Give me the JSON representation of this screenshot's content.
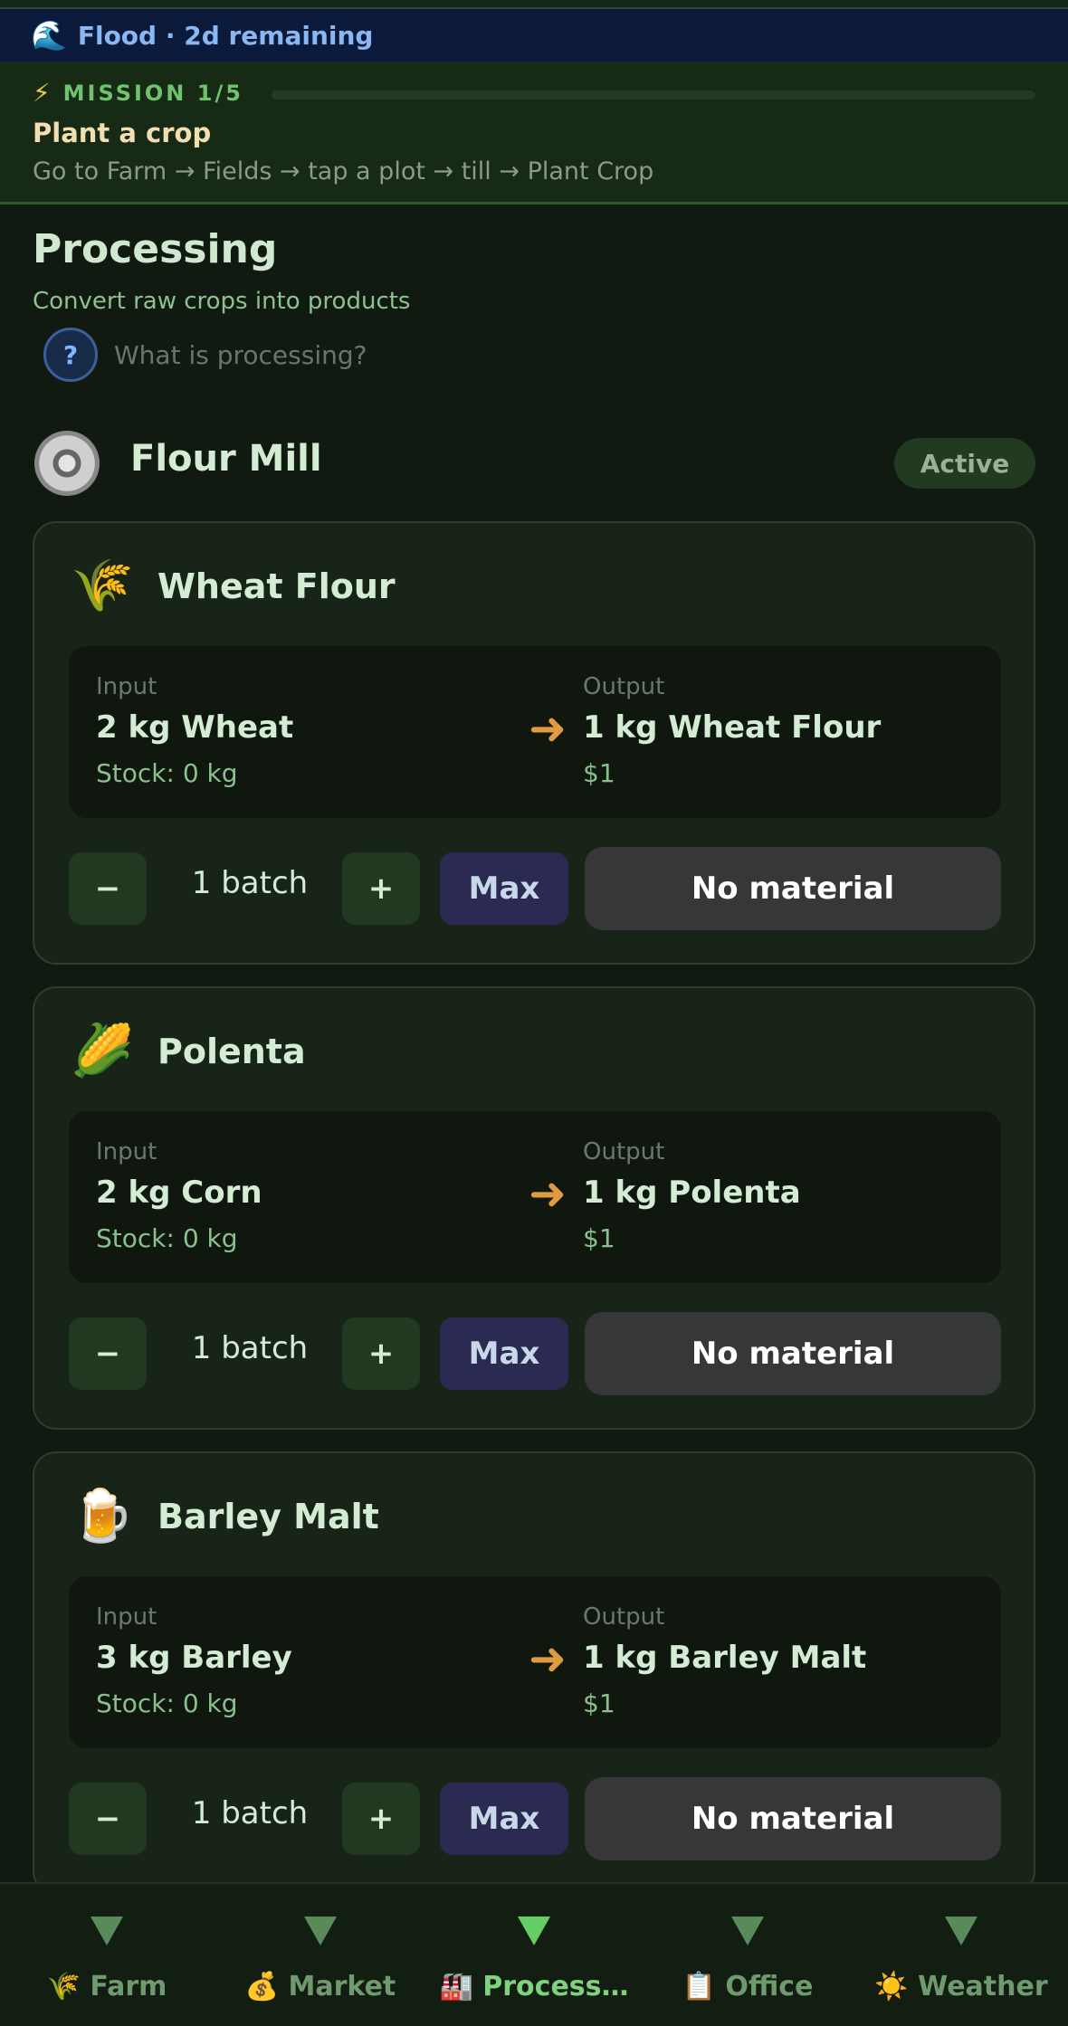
{
  "flood_bar": {
    "emoji": "🌊",
    "text": "Flood · 2d remaining"
  },
  "mission": {
    "icon": "⚡",
    "label": "MISSION 1/5",
    "progress": 0.0,
    "title": "Plant a crop",
    "description": "Go to Farm → Fields → tap a plot → till → Plant Crop"
  },
  "page": {
    "title": "Processing",
    "subtitle": "Convert raw crops into products",
    "help_icon": "?",
    "help_text": "What is processing?"
  },
  "facility": {
    "icon": "gear-icon",
    "name": "Flour Mill",
    "status": "Active"
  },
  "recipes": [
    {
      "icon": "🌾",
      "name": "Wheat Flour",
      "input_label": "Input",
      "input": "2 kg Wheat",
      "stock": "Stock: 0 kg",
      "output_label": "Output",
      "output": "1 kg Wheat Flour",
      "price": "$1",
      "minus": "−",
      "batch": "1 batch",
      "plus": "+",
      "max": "Max",
      "action": "No material"
    },
    {
      "icon": "🌽",
      "name": "Polenta",
      "input_label": "Input",
      "input": "2 kg Corn",
      "stock": "Stock: 0 kg",
      "output_label": "Output",
      "output": "1 kg Polenta",
      "price": "$1",
      "minus": "−",
      "batch": "1 batch",
      "plus": "+",
      "max": "Max",
      "action": "No material"
    },
    {
      "icon": "🍺",
      "name": "Barley Malt",
      "input_label": "Input",
      "input": "3 kg Barley",
      "stock": "Stock: 0 kg",
      "output_label": "Output",
      "output": "1 kg Barley Malt",
      "price": "$1",
      "minus": "−",
      "batch": "1 batch",
      "plus": "+",
      "max": "Max",
      "action": "No material"
    }
  ],
  "nav": [
    {
      "label": "🌾 Farm",
      "active": false
    },
    {
      "label": "💰 Market",
      "active": false
    },
    {
      "label": "🏭 Process…",
      "active": true
    },
    {
      "label": "📋 Office",
      "active": false
    },
    {
      "label": "☀️ Weather",
      "active": false
    }
  ],
  "colors": {
    "accent_green": "#7ed27e",
    "arrow": "#e09a40",
    "flood": "#0b1a3a",
    "max_button": "#2a2a52"
  }
}
